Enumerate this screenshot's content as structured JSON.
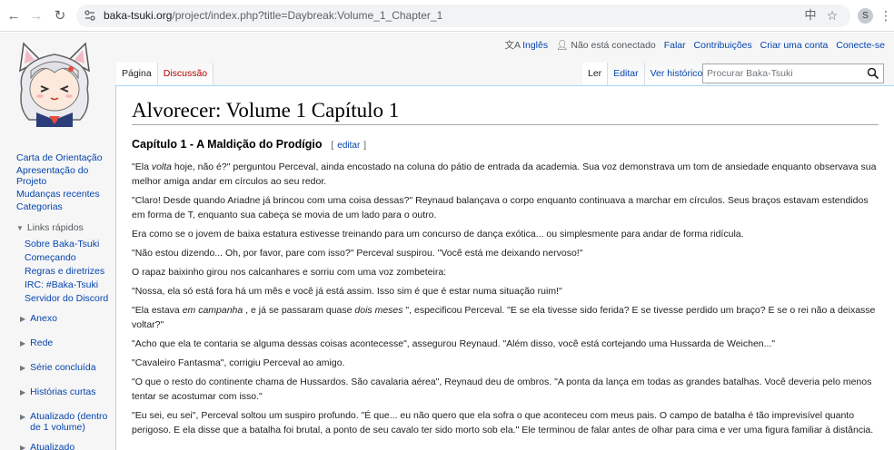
{
  "browser": {
    "url_host": "baka-tsuki.org",
    "url_rest": "/project/index.php?title=Daybreak:Volume_1_Chapter_1",
    "profile_initial": "S"
  },
  "personal": {
    "language": "Inglês",
    "not_logged": "Não está conectado",
    "talk": "Falar",
    "contributions": "Contribuições",
    "create_account": "Criar uma conta",
    "login": "Conecte-se"
  },
  "tabs": {
    "page": "Página",
    "discussion": "Discussão",
    "read": "Ler",
    "edit": "Editar",
    "history": "Ver histórico"
  },
  "search": {
    "placeholder": "Procurar Baka-Tsuki"
  },
  "sidebar": {
    "main": [
      "Carta de Orientação",
      "Apresentação do Projeto",
      "Mudanças recentes",
      "Categorias"
    ],
    "quick_links_title": "Links rápidos",
    "quick_links": [
      "Sobre Baka-Tsuki",
      "Começando",
      "Regras e diretrizes",
      "IRC: #Baka-Tsuki",
      "Servidor do Discord"
    ],
    "collapsed": [
      "Anexo",
      "Rede",
      "Série concluída",
      "Histórias curtas",
      "Atualizado (dentro de 1 volume)",
      "Atualizado"
    ]
  },
  "article": {
    "title": "Alvorecer: Volume 1 Capítulo 1",
    "section": "Capítulo 1 - A Maldição do Prodígio",
    "edit_open": "[",
    "edit_label": "editar",
    "edit_close": "]",
    "p1a": "\"Ela ",
    "p1i": "volta",
    "p1b": " hoje, não é?\" perguntou Perceval, ainda encostado na coluna do pátio de entrada da academia. Sua voz demonstrava um tom de ansiedade enquanto observava sua melhor amiga andar em círculos ao seu redor.",
    "p2": "\"Claro! Desde quando Ariadne já brincou com uma coisa dessas?\" Reynaud balançava o corpo enquanto continuava a marchar em círculos. Seus braços estavam estendidos em forma de T, enquanto sua cabeça se movia de um lado para o outro.",
    "p3": "Era como se o jovem de baixa estatura estivesse treinando para um concurso de dança exótica... ou simplesmente para andar de forma ridícula.",
    "p4": "\"Não estou dizendo... Oh, por favor, pare com isso?\" Perceval suspirou. \"Você está me deixando nervoso!\"",
    "p5": "O rapaz baixinho girou nos calcanhares e sorriu com uma voz zombeteira:",
    "p6": "\"Nossa, ela só está fora há um mês e você já está assim. Isso sim é que é estar numa situação ruim!\"",
    "p7a": "\"Ela estava ",
    "p7i1": "em campanha",
    "p7b": " , e já se passaram quase ",
    "p7i2": "dois meses",
    "p7c": " \", especificou Perceval. \"E se ela tivesse sido ferida? E se tivesse perdido um braço? E se o rei não a deixasse voltar?\"",
    "p8": "\"Acho que ela te contaria se alguma dessas coisas acontecesse\", assegurou Reynaud. \"Além disso, você está cortejando uma Hussarda de Weichen...\"",
    "p9": "\"Cavaleiro Fantasma\", corrigiu Perceval ao amigo.",
    "p10": "\"O que o resto do continente chama de Hussardos. São cavalaria aérea\", Reynaud deu de ombros. \"A ponta da lança em todas as grandes batalhas. Você deveria pelo menos tentar se acostumar com isso.\"",
    "p11": "\"Eu sei, eu sei\", Perceval soltou um suspiro profundo. \"É que... eu não quero que ela sofra o que aconteceu com meus pais. O campo de batalha é tão imprevisível quanto perigoso. E ela disse que a batalha foi brutal, a ponto de seu cavalo ter sido morto sob ela.\" Ele terminou de falar antes de olhar para cima e ver uma figura familiar à distância."
  }
}
